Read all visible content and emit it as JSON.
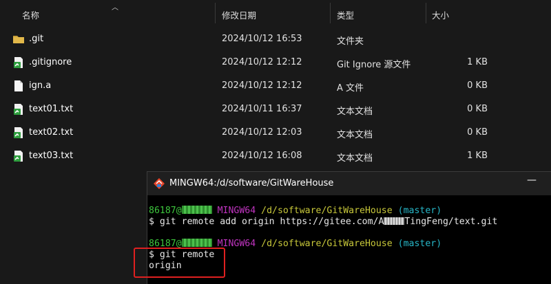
{
  "explorer": {
    "columns": {
      "name": "名称",
      "modified": "修改日期",
      "type": "类型",
      "size": "大小"
    },
    "files": [
      {
        "name": ".git",
        "date": "2024/10/12 16:53",
        "type": "文件夹",
        "size": "",
        "icon": "folder-icon"
      },
      {
        "name": ".gitignore",
        "date": "2024/10/12 12:12",
        "type": "Git Ignore 源文件",
        "size": "1 KB",
        "icon": "git-file-icon"
      },
      {
        "name": "ign.a",
        "date": "2024/10/12 12:12",
        "type": "A 文件",
        "size": "0 KB",
        "icon": "blank-file-icon"
      },
      {
        "name": "text01.txt",
        "date": "2024/10/11 16:37",
        "type": "文本文档",
        "size": "0 KB",
        "icon": "git-file-icon"
      },
      {
        "name": "text02.txt",
        "date": "2024/10/12 12:03",
        "type": "文本文档",
        "size": "0 KB",
        "icon": "git-file-icon"
      },
      {
        "name": "text03.txt",
        "date": "2024/10/12 16:08",
        "type": "文本文档",
        "size": "1 KB",
        "icon": "git-file-icon"
      }
    ]
  },
  "terminal": {
    "title": "MINGW64:/d/software/GitWareHouse",
    "minimize": "—",
    "prompt1": {
      "user": "86187@",
      "env": "MINGW64",
      "path": "/d/software/GitWareHouse",
      "branch": "(master)"
    },
    "cmd1_prefix": "$ git remote add origin https://gitee.com/A",
    "cmd1_suffix": "TingFeng/text.git",
    "prompt2": {
      "user": "86187@",
      "env": "MINGW64",
      "path": "/d/software/GitWareHouse",
      "branch": "(master)"
    },
    "cmd2": "$ git remote",
    "output": "origin"
  },
  "colors": {
    "highlight": "#e02020",
    "prompt_user": "#3dc73d",
    "prompt_env": "#c034c0",
    "prompt_path": "#c8c83a",
    "prompt_branch": "#27b7c8"
  }
}
